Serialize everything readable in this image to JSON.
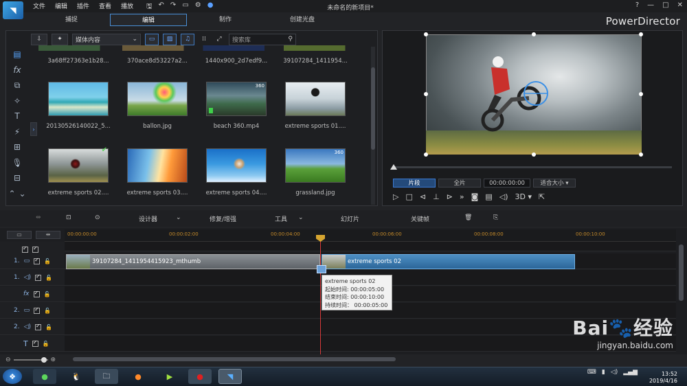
{
  "window": {
    "title": "未命名的新项目*",
    "menu": [
      "文件",
      "编辑",
      "插件",
      "查看",
      "播放"
    ],
    "brand": "PowerDirector",
    "buttons": [
      "?",
      "—",
      "□",
      "✕"
    ]
  },
  "mode_tabs": [
    {
      "label": "捕捉",
      "active": false
    },
    {
      "label": "编辑",
      "active": true
    },
    {
      "label": "制作",
      "active": false
    },
    {
      "label": "创建光盘",
      "active": false
    }
  ],
  "library": {
    "dropdown": "媒体内容",
    "search_placeholder": "搜索库",
    "top_row": [
      "3a68ff27363e1b28...",
      "370ace8d53227a2...",
      "1440x900_2d7edf9...",
      "39107284_1411954..."
    ],
    "items": [
      {
        "name": "20130526140022_5...",
        "badge": "",
        "checked": false
      },
      {
        "name": "ballon.jpg",
        "badge": "",
        "checked": false
      },
      {
        "name": "beach 360.mp4",
        "badge": "360",
        "checked": false
      },
      {
        "name": "extreme sports 01....",
        "badge": "",
        "checked": false
      },
      {
        "name": "extreme sports 02....",
        "badge": "",
        "checked": true
      },
      {
        "name": "extreme sports 03....",
        "badge": "",
        "checked": false
      },
      {
        "name": "extreme sports 04....",
        "badge": "",
        "checked": false
      },
      {
        "name": "grassland.jpg",
        "badge": "360",
        "checked": false
      }
    ]
  },
  "preview": {
    "tab_clip": "片段",
    "tab_full": "全片",
    "timecode": "00:00:00:00",
    "fit": "适合大小",
    "mode_3d": "3D"
  },
  "edit_toolbar": {
    "designer": "设计器",
    "fix": "修复/增强",
    "tools": "工具",
    "slideshow": "幻灯片",
    "keyframe": "关键帧"
  },
  "timeline": {
    "ruler": [
      "00:00:00:00",
      "00:00:02:00",
      "00:00:04:00",
      "00:00:06:00",
      "00:00:08:00",
      "00:00:10:00"
    ],
    "tracks": [
      "1.",
      "1.",
      "fx",
      "2.",
      "2.",
      "T"
    ],
    "clip1": "39107284_1411954415923_mthumb",
    "clip2": "extreme sports 02",
    "tooltip": {
      "title": "extreme sports 02",
      "start": "起始时间: 00:00:05:00",
      "end": "结束时间: 00:00:10:00",
      "duration": "持续时间： 00:00:05:00"
    }
  },
  "taskbar": {
    "date": "2019/4/16",
    "time": "13:52"
  },
  "watermark": {
    "big": "Bai🐾经验",
    "small": "jingyan.baidu.com"
  },
  "colors": {
    "accent": "#4a8fd6",
    "clip_blue": "#2c6699",
    "playhead": "#d93a3a"
  }
}
